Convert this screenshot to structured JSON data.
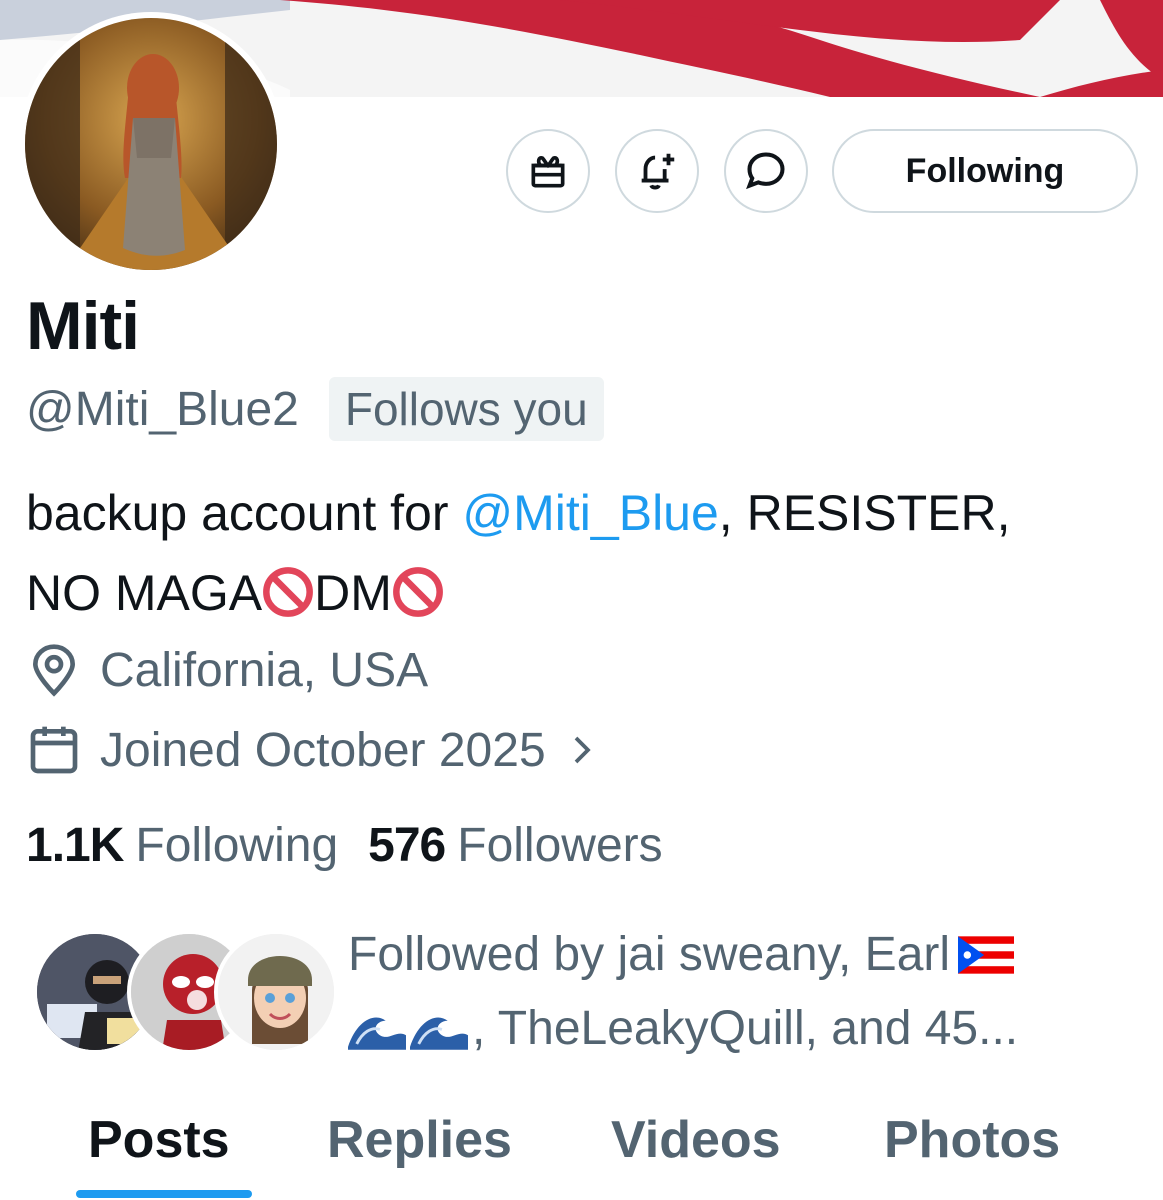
{
  "profile": {
    "name": "Miti",
    "handle": "@Miti_Blue2",
    "follows_you_badge": "Follows you",
    "bio_prefix": "backup account for ",
    "bio_mention": "@Miti_Blue",
    "bio_suffix": ", RESISTER,",
    "bio_line2_a": "NO MAGA",
    "bio_line2_b": "DM",
    "location": "California, USA",
    "joined": "Joined October 2025"
  },
  "actions": {
    "gift_icon": "gift-icon",
    "notify_icon": "bell-plus-icon",
    "message_icon": "message-bubble-icon",
    "follow_label": "Following"
  },
  "stats": {
    "following_count": "1.1K",
    "following_label": "Following",
    "followers_count": "576",
    "followers_label": "Followers"
  },
  "followed_by": {
    "line1": "Followed by jai sweany, Earl",
    "line2": ", TheLeakyQuill, and 45..."
  },
  "tabs": [
    {
      "label": "Posts",
      "active": true
    },
    {
      "label": "Replies",
      "active": false
    },
    {
      "label": "Videos",
      "active": false
    },
    {
      "label": "Photos",
      "active": false
    }
  ],
  "colors": {
    "accent": "#1d9bf0",
    "secondary_text": "#536471",
    "primary_text": "#0f1419",
    "border": "#cfd9de"
  }
}
